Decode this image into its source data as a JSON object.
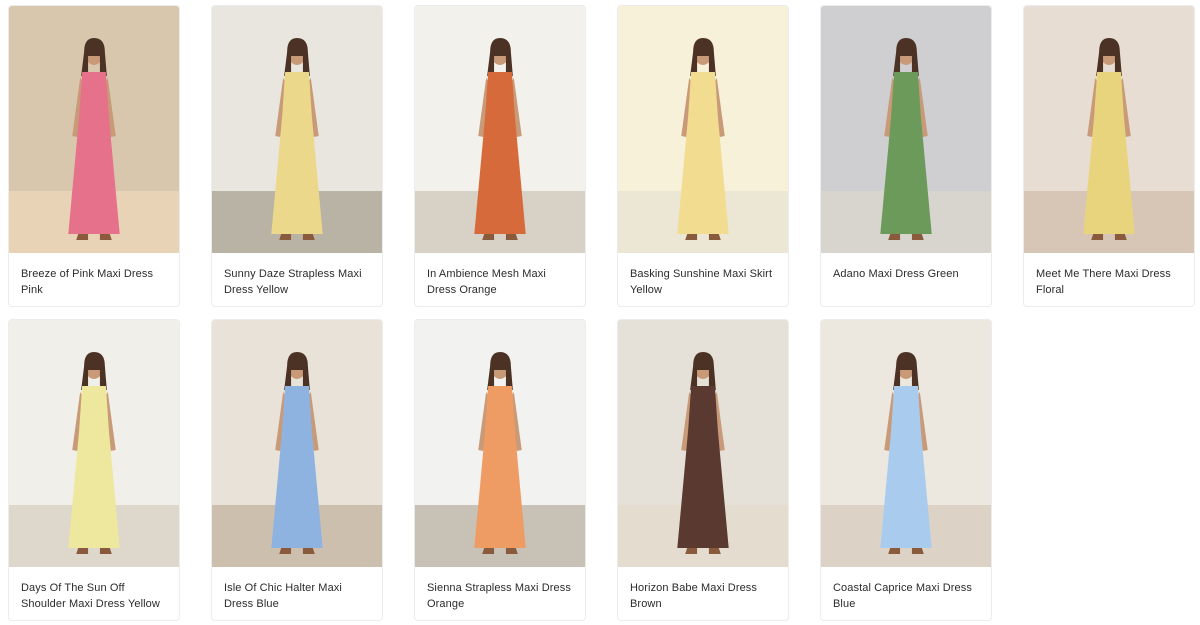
{
  "products": [
    {
      "name": "Breeze of Pink Maxi Dress Pink",
      "dress_color": "#e5718a",
      "bg": "#d9c7ad",
      "floor": "#e8d3b7"
    },
    {
      "name": "Sunny Daze Strapless Maxi Dress Yellow",
      "dress_color": "#ecd88a",
      "bg": "#e9e6df",
      "floor": "#b9b3a6"
    },
    {
      "name": "In Ambience Mesh Maxi Dress Orange",
      "dress_color": "#d76a3a",
      "bg": "#f3f1ec",
      "floor": "#d8d2c6"
    },
    {
      "name": "Basking Sunshine Maxi Skirt Yellow",
      "dress_color": "#f2dc8f",
      "bg": "#f7f1da",
      "floor": "#ece6d5"
    },
    {
      "name": "Adano Maxi Dress Green",
      "dress_color": "#6b9a5b",
      "bg": "#cfcfd1",
      "floor": "#d8d4ce"
    },
    {
      "name": "Meet Me There Maxi Dress Floral",
      "dress_color": "#e9d47e",
      "bg": "#e8ddd3",
      "floor": "#d7c6b6"
    },
    {
      "name": "Days Of The Sun Off Shoulder Maxi Dress Yellow",
      "dress_color": "#eee89e",
      "bg": "#f1efea",
      "floor": "#ddd7cc"
    },
    {
      "name": "Isle Of Chic Halter Maxi Dress Blue",
      "dress_color": "#8eb3e1",
      "bg": "#e8e2d8",
      "floor": "#cdbfae"
    },
    {
      "name": "Sienna Strapless Maxi Dress Orange",
      "dress_color": "#ef9b64",
      "bg": "#f2f2f0",
      "floor": "#c8c1b5"
    },
    {
      "name": "Horizon Babe Maxi Dress Brown",
      "dress_color": "#5a3a30",
      "bg": "#e5e0d8",
      "floor": "#e3dccf"
    },
    {
      "name": "Coastal Caprice Maxi Dress Blue",
      "dress_color": "#a9ccee",
      "bg": "#ece7df",
      "floor": "#dcd3c6"
    }
  ]
}
